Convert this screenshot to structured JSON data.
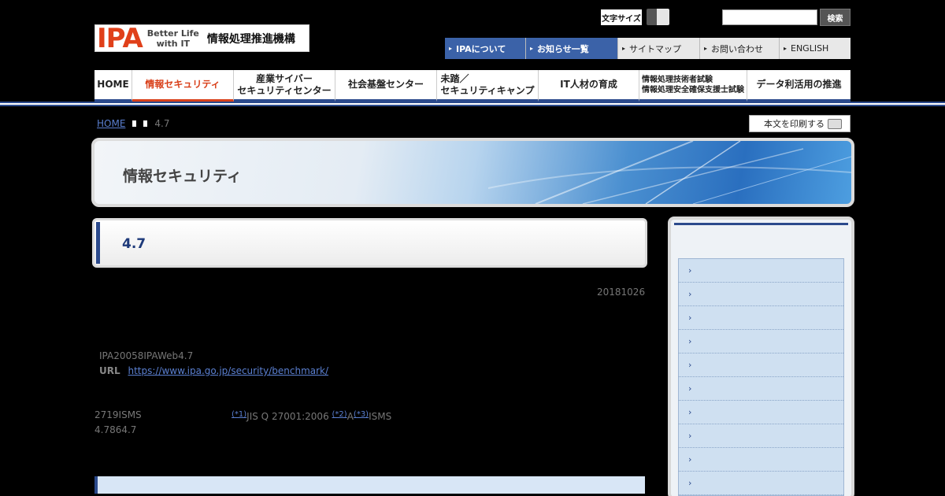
{
  "header": {
    "logo_mark": "IPA",
    "logo_tagline_1": "Better Life",
    "logo_tagline_2": "with IT",
    "logo_org": "情報処理推進機構",
    "fontsize_label": "文字サイズ",
    "search_placeholder": "",
    "search_button": "検索"
  },
  "topnav": [
    {
      "label": "IPAについて",
      "style": "blue"
    },
    {
      "label": "お知らせ一覧",
      "style": "blue"
    },
    {
      "label": "サイトマップ",
      "style": "gray"
    },
    {
      "label": "お問い合わせ",
      "style": "gray"
    },
    {
      "label": "ENGLISH",
      "style": "gray"
    }
  ],
  "gnav": [
    {
      "line1": "HOME",
      "line2": ""
    },
    {
      "line1": "情報セキュリティ",
      "line2": ""
    },
    {
      "line1": "産業サイバー",
      "line2": "セキュリティセンター"
    },
    {
      "line1": "社会基盤センター",
      "line2": ""
    },
    {
      "line1": "未踏／",
      "line2": "セキュリティキャンプ"
    },
    {
      "line1": "IT人材の育成",
      "line2": ""
    },
    {
      "line1": "情報処理技術者試験",
      "line2": "情報処理安全確保支援士試験"
    },
    {
      "line1": "データ利活用の推進",
      "line2": ""
    }
  ],
  "breadcrumb": {
    "home": "HOME",
    "current": "4.7"
  },
  "print_label": "本文を印刷する",
  "banner_title": "情報セキュリティ",
  "page_title": "4.7",
  "date": "20181026",
  "lead": "IPA20058IPAWeb4.7",
  "url_label": "URL",
  "url": "https://www.ipa.go.jp/security/benchmark/",
  "para": {
    "text1": "2719ISMS",
    "ref1": "(*1)",
    "text2": "JIS Q 27001:2006",
    "ref2": "(*2)",
    "text3": "A",
    "ref3": "(*3)",
    "text4": "ISMS",
    "line2": "4.7864.7"
  },
  "sidebar": {
    "items": [
      "›",
      "›",
      "›",
      "›",
      "›",
      "›",
      "›",
      "›",
      "›",
      "›"
    ]
  },
  "colors": {
    "brand": "#e0401a",
    "nav_blue": "#3b62a8",
    "accent_dark": "#2b4a8c",
    "link": "#5a7fd0"
  }
}
